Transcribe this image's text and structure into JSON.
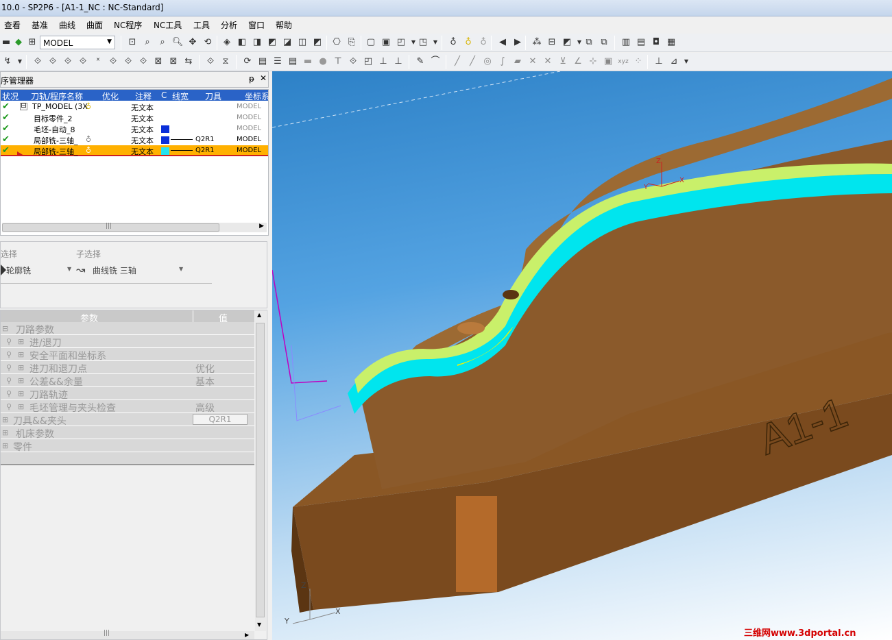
{
  "window": {
    "title": "10.0 - SP2P6 - [A1-1_NC : NC-Standard]"
  },
  "menu": [
    "查看",
    "基准",
    "曲线",
    "曲面",
    "NC程序",
    "NC工具",
    "工具",
    "分析",
    "窗口",
    "帮助"
  ],
  "toolbar": {
    "model_combo": "MODEL"
  },
  "op_manager": {
    "title": "序管理器",
    "pin": "ᵽ",
    "close": "✕",
    "columns": [
      "状况",
      "刀轨/程序名称",
      "优化",
      "注释",
      "C",
      "线宽",
      "刀具",
      "坐标系"
    ],
    "rows": [
      {
        "name": "TP_MODEL (3X",
        "comment": "无文本",
        "tool": "",
        "cs": "MODEL",
        "toggle": "⊟"
      },
      {
        "name": "目标零件_2",
        "comment": "无文本",
        "tool": "",
        "cs": "MODEL"
      },
      {
        "name": "毛坯-自动_8",
        "comment": "无文本",
        "tool": "",
        "cs": "MODEL"
      },
      {
        "name": "局部铣-三轴_",
        "comment": "无文本",
        "tool": "Q2R1",
        "cs": "MODEL"
      },
      {
        "name": "局部铣-三轴_",
        "comment": "无文本",
        "tool": "Q2R1",
        "cs": "MODEL"
      }
    ],
    "colors": {
      "blue": "#0a2fd9",
      "cyan": "#23e3f0",
      "selected": "#ffb000"
    }
  },
  "selection": {
    "label": "选择",
    "value": "轮廓铣",
    "sub_label": "子选择",
    "sub_value": "曲线铣 三轴"
  },
  "params": {
    "header_name": "参数",
    "header_value": "值",
    "rows": [
      {
        "label": "刀路参数",
        "value": ""
      },
      {
        "label": "进/退刀",
        "value": ""
      },
      {
        "label": "安全平面和坐标系",
        "value": ""
      },
      {
        "label": "进刀和退刀点",
        "value": "优化"
      },
      {
        "label": "公差&&余量",
        "value": "基本"
      },
      {
        "label": "刀路轨迹",
        "value": ""
      },
      {
        "label": "毛坯管理与夹头检查",
        "value": "高级"
      },
      {
        "label": "刀具&&夹头",
        "value": "Q2R1"
      },
      {
        "label": "机床参数",
        "value": ""
      },
      {
        "label": "零件",
        "value": ""
      }
    ]
  },
  "viewport": {
    "part_text": "A1-1",
    "axis_z": "Z",
    "axis_y": "Y",
    "axis_x": "X",
    "watermark": "三维网www.3dportal.cn"
  }
}
